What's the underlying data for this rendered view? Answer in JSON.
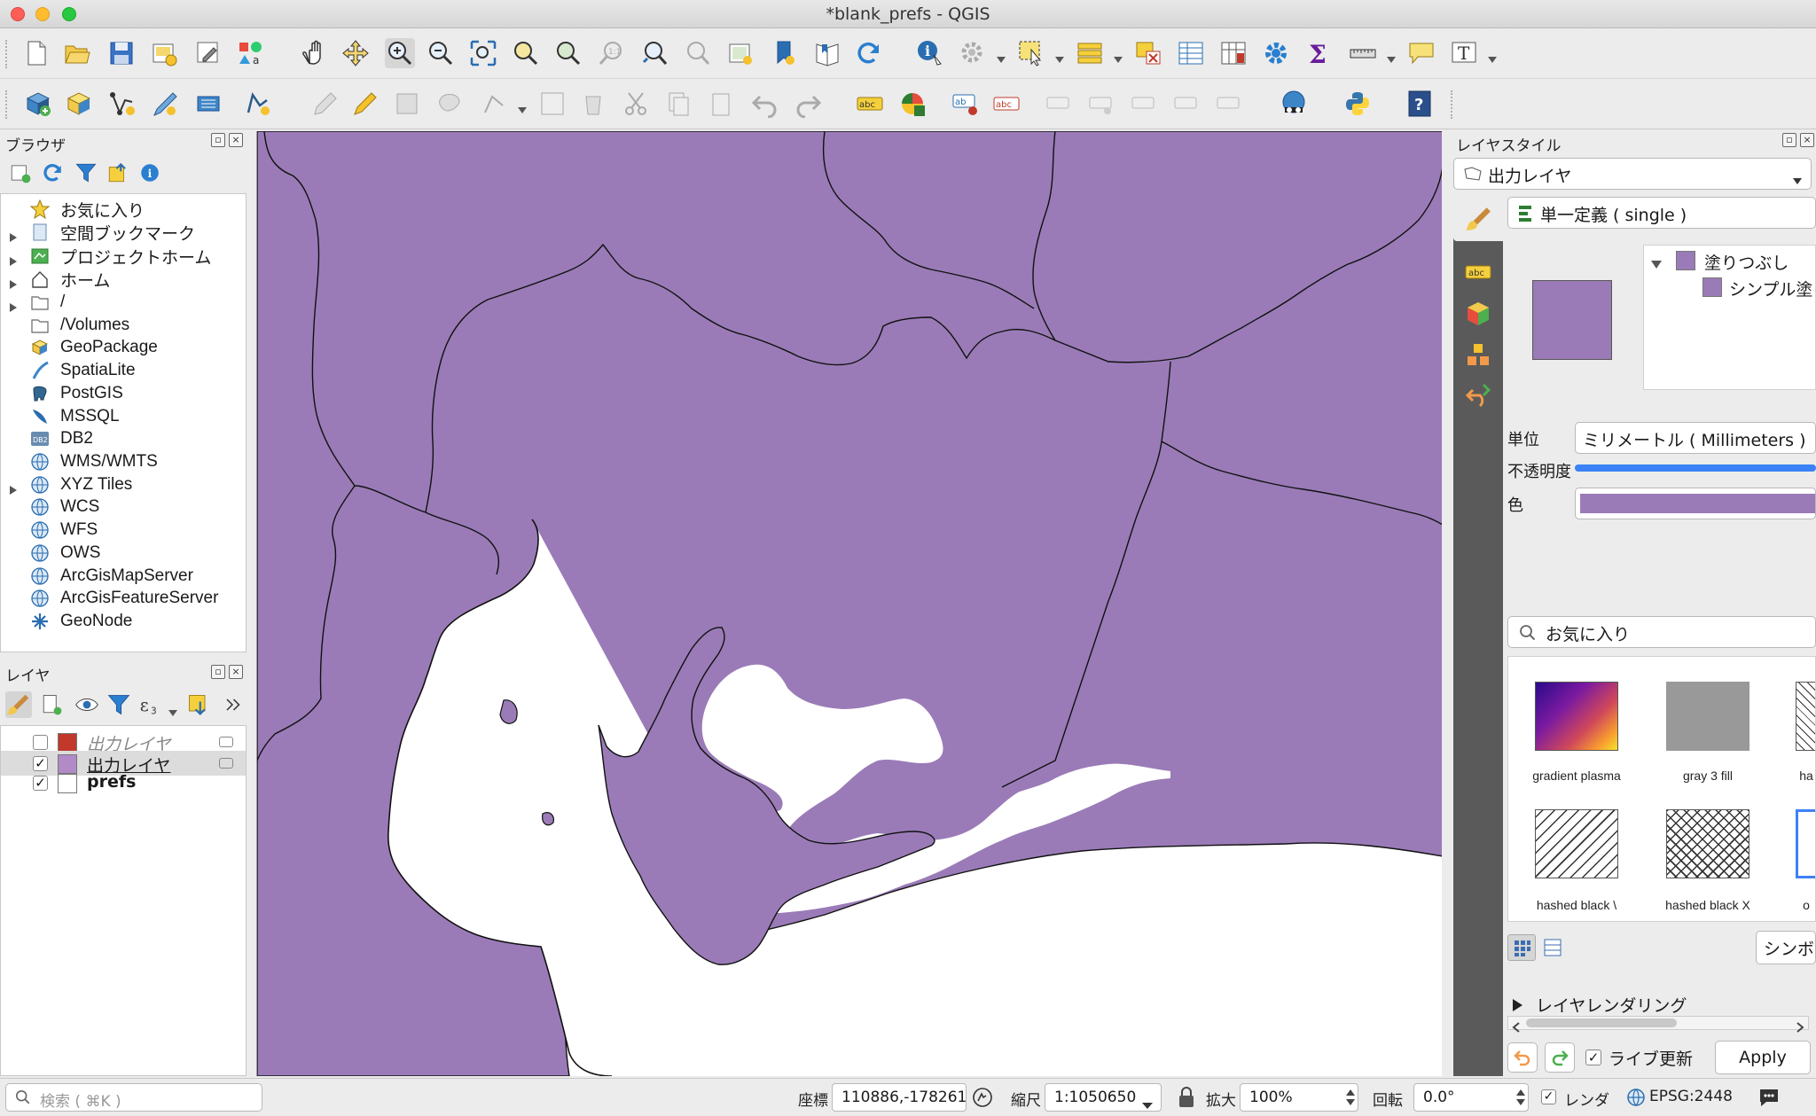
{
  "window": {
    "title": "*blank_prefs - QGIS"
  },
  "icons": {
    "toolbar1": [
      "new-project-icon",
      "open-project-icon",
      "save-project-icon",
      "new-print-layout-icon",
      "layout-manager-icon",
      "style-manager-icon",
      "pan-icon",
      "pan-to-selection-icon",
      "zoom-in-icon",
      "zoom-out-icon",
      "zoom-full-icon",
      "zoom-to-selection-icon",
      "zoom-to-layer-icon",
      "zoom-native-icon",
      "zoom-last-icon",
      "zoom-next-icon",
      "new-map-view-icon",
      "new-bookmark-icon",
      "show-bookmarks-icon",
      "refresh-icon",
      "identify-icon",
      "actions-icon",
      "select-features-icon",
      "select-by-value-icon",
      "deselect-icon",
      "attribute-table-icon",
      "field-calculator-icon",
      "processing-toolbox-icon",
      "statistics-icon",
      "measure-icon",
      "map-tips-icon",
      "text-annotation-icon"
    ],
    "toolbar2": [
      "data-source-manager-icon",
      "new-geopackage-layer-icon",
      "new-shapefile-layer-icon",
      "new-temporary-layer-icon",
      "new-virtual-layer-icon",
      "digitizing-icon",
      "current-edits-icon",
      "toggle-editing-icon",
      "save-edits-icon",
      "add-feature-icon",
      "vertex-tool-icon",
      "modify-attributes-icon",
      "delete-selected-icon",
      "cut-features-icon",
      "copy-features-icon",
      "paste-features-icon",
      "undo-icon",
      "redo-icon",
      "label-icon",
      "diagram-icon",
      "pin-labels-icon",
      "highlight-labels-icon",
      "show-hide-labels-icon",
      "move-label-icon",
      "rotate-label-icon",
      "change-label-icon",
      "qms-icon",
      "python-console-icon",
      "help-icon"
    ]
  },
  "browser": {
    "title": "ブラウザ",
    "items": [
      {
        "label": "お気に入り",
        "icon": "star-icon",
        "expandable": false
      },
      {
        "label": "空間ブックマーク",
        "icon": "bookmark-icon",
        "expandable": true
      },
      {
        "label": "プロジェクトホーム",
        "icon": "project-home-icon",
        "expandable": true
      },
      {
        "label": "ホーム",
        "icon": "home-icon",
        "expandable": true
      },
      {
        "label": "/",
        "icon": "folder-icon",
        "expandable": true
      },
      {
        "label": "/Volumes",
        "icon": "folder-icon",
        "expandable": false
      },
      {
        "label": "GeoPackage",
        "icon": "geopackage-icon",
        "expandable": false
      },
      {
        "label": "SpatiaLite",
        "icon": "spatialite-icon",
        "expandable": false
      },
      {
        "label": "PostGIS",
        "icon": "postgis-icon",
        "expandable": false
      },
      {
        "label": "MSSQL",
        "icon": "mssql-icon",
        "expandable": false
      },
      {
        "label": "DB2",
        "icon": "db2-icon",
        "expandable": false
      },
      {
        "label": "WMS/WMTS",
        "icon": "wms-icon",
        "expandable": false
      },
      {
        "label": "XYZ Tiles",
        "icon": "xyz-tiles-icon",
        "expandable": true
      },
      {
        "label": "WCS",
        "icon": "wcs-icon",
        "expandable": false
      },
      {
        "label": "WFS",
        "icon": "wfs-icon",
        "expandable": false
      },
      {
        "label": "OWS",
        "icon": "ows-icon",
        "expandable": false
      },
      {
        "label": "ArcGisMapServer",
        "icon": "arcgis-map-icon",
        "expandable": false
      },
      {
        "label": "ArcGisFeatureServer",
        "icon": "arcgis-feature-icon",
        "expandable": false
      },
      {
        "label": "GeoNode",
        "icon": "geonode-icon",
        "expandable": false
      }
    ]
  },
  "layers": {
    "title": "レイヤ",
    "items": [
      {
        "label": "出力レイヤ",
        "checked": false,
        "color": "#c0392b",
        "italic": true
      },
      {
        "label": "出力レイヤ",
        "checked": true,
        "color": "#b18ac7",
        "italic": false,
        "selected": true
      },
      {
        "label": "prefs",
        "checked": true,
        "color": "#ffffff",
        "bold": true
      }
    ]
  },
  "style_panel": {
    "title": "レイヤスタイル",
    "layer_select": "出力レイヤ",
    "renderer_select": "単一定義 ( single )",
    "symbol_tree": {
      "root": "塗りつぶし",
      "child": "シンプル塗"
    },
    "unit_label": "単位",
    "unit_value": "ミリメートル ( Millimeters )",
    "opacity_label": "不透明度",
    "opacity_value": 100,
    "color_label": "色",
    "fill_color": "#9a7bb7",
    "search_value": "お気に入り",
    "favorites": [
      {
        "label": "gradient  plasma"
      },
      {
        "label": "gray 3 fill"
      },
      {
        "label": "ha"
      },
      {
        "label": "hashed black \\"
      },
      {
        "label": "hashed black X"
      },
      {
        "label": "o"
      }
    ],
    "symbol_button": "シンボ",
    "layer_rendering": "レイヤレンダリング",
    "live_update": "ライブ更新",
    "live_update_checked": true,
    "apply": "Apply"
  },
  "status": {
    "search_placeholder": "検索 ( ⌘K )",
    "coord_label": "座標",
    "coord_value": "110886,-178261",
    "scale_label": "縮尺",
    "scale_value": "1:1050650",
    "magnifier_label": "拡大",
    "magnifier_value": "100%",
    "rotation_label": "回転",
    "rotation_value": "0.0°",
    "render_label": "レンダ",
    "render_checked": true,
    "crs": "EPSG:2448"
  },
  "colors": {
    "map_fill": "#9a7bb7",
    "accent": "#3b82f6"
  }
}
